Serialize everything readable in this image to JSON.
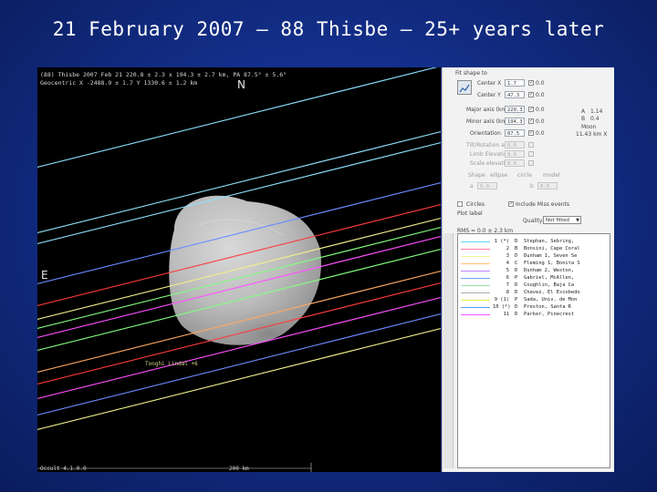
{
  "slide": {
    "title": "21 February 2007 – 88 Thisbe – 25+ years later"
  },
  "plot": {
    "header_line1": "(88) Thisbe 2007 Feb 21  220.8 ± 2.3 x 194.3 ± 2.7 km, PA 87.5° ± 5.6°",
    "header_line2": "Geocentric  X -2488.9 ± 1.7  Y 1330.6 ± 1.2 km",
    "north": "N",
    "east": "E",
    "chord_tag": "Tonghi Lindal  +6",
    "scale_left": "Occult 4.1.0.0",
    "scale_mid": "200 km",
    "background": "#000000",
    "body_color": "#bdbdbd"
  },
  "panel": {
    "group_label": "Fit shape to",
    "rows": [
      {
        "label": "Center X",
        "value": "1.7",
        "sd": "0.0"
      },
      {
        "label": "Center Y",
        "value": "47.3",
        "sd": "0.0"
      },
      {
        "label": "Major axis (km)",
        "value": "220.3",
        "sd": "0.0"
      },
      {
        "label": "Minor axis (km)",
        "value": "194.3",
        "sd": "0.0"
      },
      {
        "label": "Orientation",
        "value": "87.5",
        "sd": "0.0"
      }
    ],
    "dim_rows": [
      {
        "label": "Tilt/Rotation angle",
        "value": "0.0"
      },
      {
        "label": "Limb Elevation",
        "value": "0.0"
      },
      {
        "label": "Scale elevation",
        "value": "0.0"
      }
    ],
    "moon_label": "Moon",
    "moon_value": "11.43 km  X",
    "ratio_label1": "A",
    "ratio_val1": "1.14",
    "ratio_label2": "B",
    "ratio_val2": "0.4",
    "shape_label": "Shape",
    "shape_opts": [
      "ellipse",
      "circle",
      "model"
    ],
    "dim_a_label": "a",
    "dim_a_value": "0.0",
    "dim_b_label": "b",
    "dim_b_value": "0.0",
    "circles_label": "Circles",
    "limb_label": "Include Miss events",
    "plot_label": "Plot label",
    "quality_label": "Quality",
    "quality_value": "Not fitted",
    "list_header": "RMS = 0.0 ± 2.3 km",
    "chords": [
      {
        "num": "1 (*)",
        "code": "D",
        "obs": "Stephan, Sebring,",
        "color": "#5bd3ff"
      },
      {
        "num": "2",
        "code": "B",
        "obs": "Bonsini, Cape Coral",
        "color": "#ff7aa8"
      },
      {
        "num": "3",
        "code": "D",
        "obs": "Dunham 1, Seven Se",
        "color": "#eef58a"
      },
      {
        "num": "4",
        "code": "C",
        "obs": "Fleming 1, Bonita S",
        "color": "#ffbf80"
      },
      {
        "num": "5",
        "code": "D",
        "obs": "Dunham 2, Weston,",
        "color": "#b986ff"
      },
      {
        "num": "6",
        "code": "P",
        "obs": "Gabriel, McAllen,",
        "color": "#6aa8ff"
      },
      {
        "num": "7",
        "code": "D",
        "obs": "Coughlin, Baja Ca",
        "color": "#9ce0a8"
      },
      {
        "num": "8",
        "code": "D",
        "obs": "Chavez, El Escobedo",
        "color": "#aaaaaa"
      },
      {
        "num": "9 (1)",
        "code": "P",
        "obs": "Sada, Univ. de Mon",
        "color": "#e3f04a"
      },
      {
        "num": "10 (*)",
        "code": "D",
        "obs": "Preston, Santa R",
        "color": "#4aa0ff"
      },
      {
        "num": "11",
        "code": "D",
        "obs": "Parker, Pinecrest",
        "color": "#ff58ff"
      }
    ]
  },
  "colors": {
    "cyan": "#8de0ff",
    "red": "#ff3b3b",
    "yellow": "#f0f08a",
    "green": "#7fff7f",
    "magenta": "#ff50ff",
    "blue": "#6a8cff",
    "orange": "#ffa860"
  }
}
